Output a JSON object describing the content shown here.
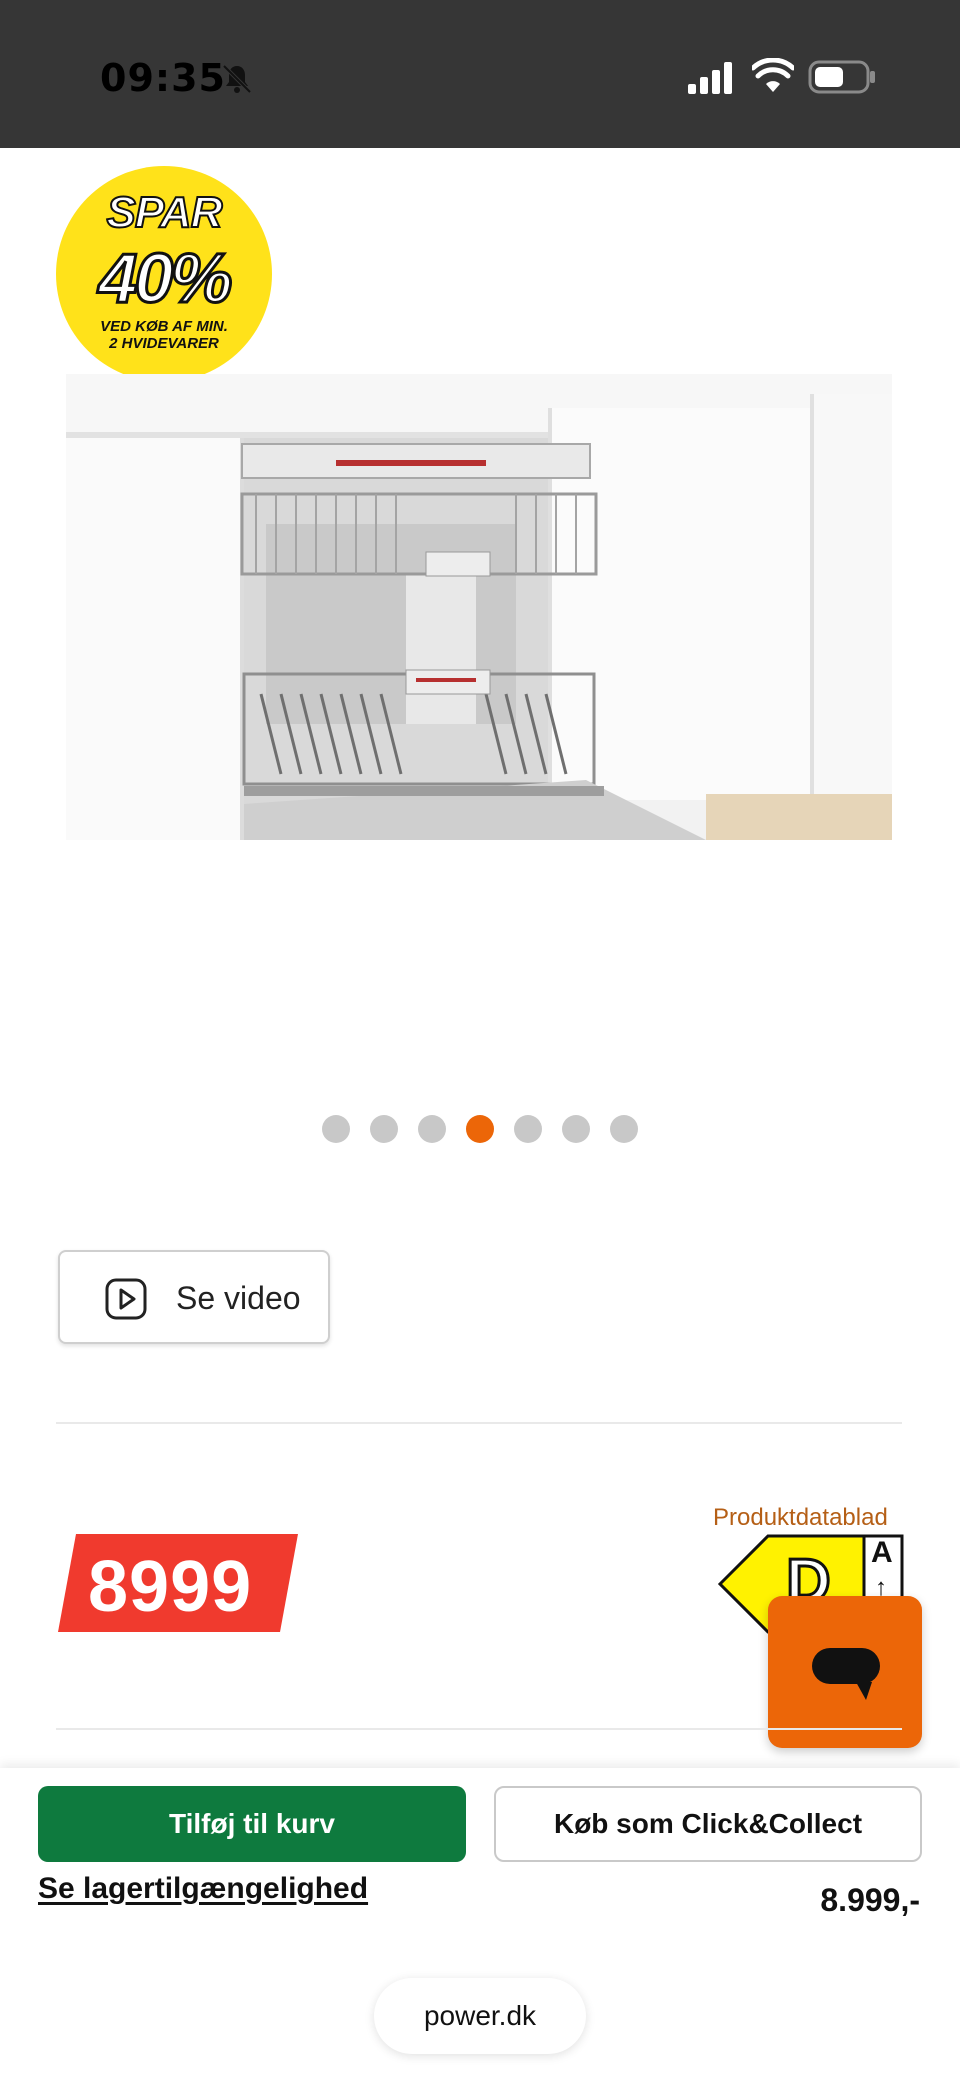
{
  "status_bar": {
    "time": "09:35",
    "icons": [
      "bell-slash-icon",
      "signal-icon",
      "wifi-icon",
      "battery-icon"
    ]
  },
  "promo_badge": {
    "line1": "SPAR",
    "line2": "40%",
    "line3a": "VED KØB AF MIN.",
    "line3b": "2 HVIDEVARER",
    "color": "#ffe21a"
  },
  "product_image": {
    "description_icon": "dishwasher-image"
  },
  "carousel": {
    "count": 7,
    "active_index": 3,
    "active_color": "#ec6608"
  },
  "video_button": {
    "label": "Se video",
    "icon": "play-icon"
  },
  "price": {
    "value": "8999",
    "color": "#f03a2e"
  },
  "energy": {
    "link_label": "Produktdatablad",
    "grade": "D",
    "top_class": "A",
    "arrow": "↑",
    "color": "#fff200"
  },
  "chat": {
    "icon": "chat-bubble-icon",
    "color": "#ec6608"
  },
  "actions": {
    "add_to_cart": "Tilføj til kurv",
    "click_collect": "Køb som Click&Collect",
    "stock_link": "Se lagertilgængelighed",
    "price_text": "8.999,-",
    "primary_color": "#0e7a3e"
  },
  "browser": {
    "url": "power.dk"
  }
}
